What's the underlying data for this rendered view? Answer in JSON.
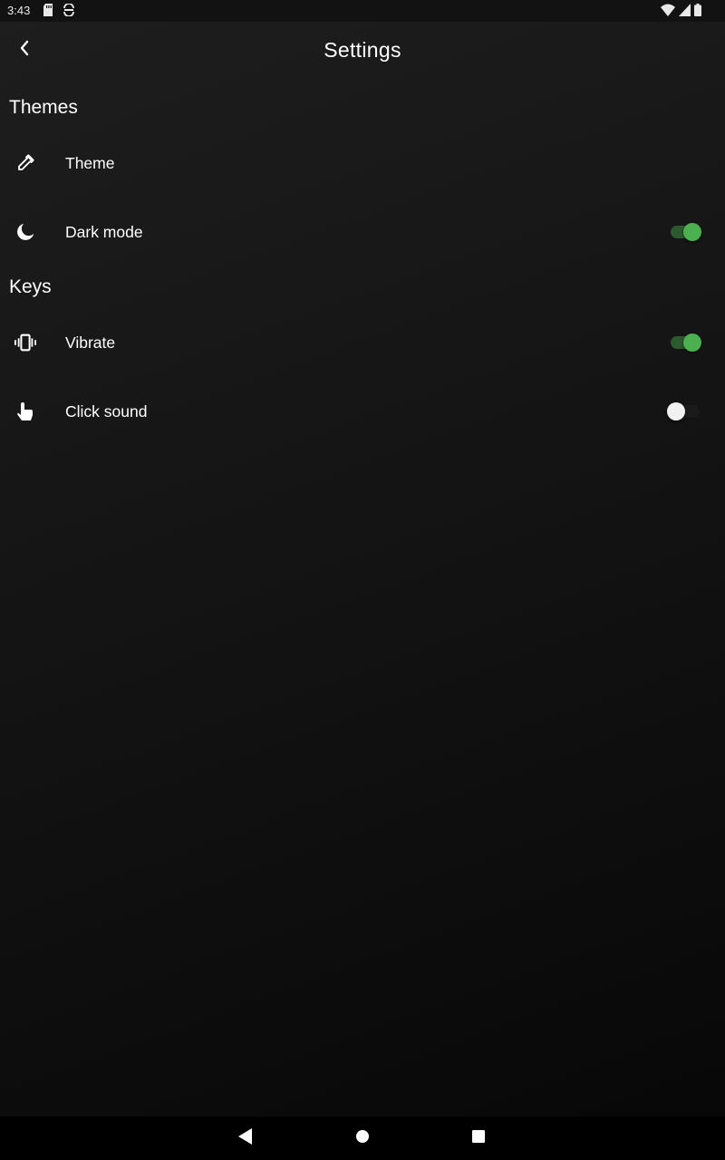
{
  "status_bar": {
    "time": "3:43",
    "left_icons": [
      "sd-card-icon",
      "storage-sync-icon"
    ],
    "right_icons": [
      "wifi-icon",
      "cellular-signal-icon",
      "battery-icon"
    ]
  },
  "app_bar": {
    "title": "Settings",
    "back_icon": "chevron-left-icon"
  },
  "sections": [
    {
      "title": "Themes",
      "items": [
        {
          "label": "Theme",
          "icon": "eyedropper-icon",
          "has_switch": false
        },
        {
          "label": "Dark mode",
          "icon": "moon-icon",
          "has_switch": true,
          "switch_on": true
        }
      ]
    },
    {
      "title": "Keys",
      "items": [
        {
          "label": "Vibrate",
          "icon": "vibrate-icon",
          "has_switch": true,
          "switch_on": true
        },
        {
          "label": "Click sound",
          "icon": "touch-hand-icon",
          "has_switch": true,
          "switch_on": false
        }
      ]
    }
  ],
  "nav_bar": {
    "icons": [
      "back-triangle-icon",
      "home-circle-icon",
      "recents-square-icon"
    ]
  },
  "colors": {
    "accent": "#4caf50",
    "accent_track": "#2c5a2e",
    "background": "#161616",
    "text": "#ffffff"
  }
}
